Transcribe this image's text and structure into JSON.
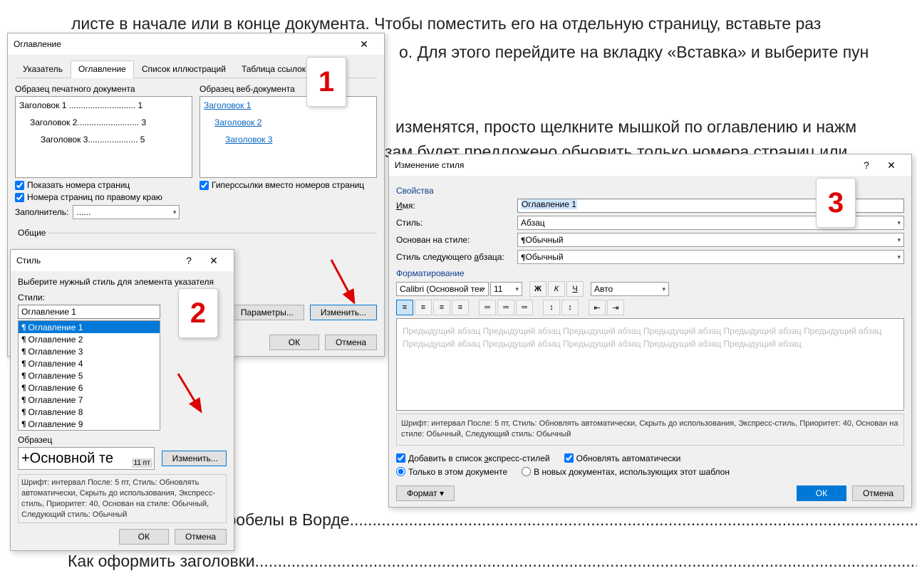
{
  "bg": {
    "line1": "листе в начале или в конце документа. Чтобы поместить его на отдельную страницу, вставьте раз",
    "line2": "о. Для этого перейдите на вкладку «Вставка» и выберите пун",
    "line3": "изменятся, просто щелкните мышкой по оглавлению и нажм",
    "line4": "зам будет предложено обновить только номера страниц или",
    "line5": "Как убрать лишние пробелы в Ворде",
    "line6": "Как оформить заголовки"
  },
  "dlg1": {
    "title": "Оглавление",
    "tabs": [
      "Указатель",
      "Оглавление",
      "Список иллюстраций",
      "Таблица ссылок"
    ],
    "preview_print_label": "Образец печатного документа",
    "preview_web_label": "Образец веб-документа",
    "print_lines": [
      "Заголовок 1 ............................ 1",
      "Заголовок 2.......................... 3",
      "Заголовок 3..................... 5"
    ],
    "web_lines": [
      "Заголовок 1",
      "Заголовок 2",
      "Заголовок 3"
    ],
    "chk_show_pages": "Показать номера страниц",
    "chk_right_align": "Номера страниц по правому краю",
    "chk_hyperlinks": "Гиперссылки вместо номеров страниц",
    "filler_label": "Заполнитель:",
    "filler_value": "......",
    "general_label": "Общие",
    "btn_params": "Параметры...",
    "btn_modify": "Изменить...",
    "btn_ok": "ОК",
    "btn_cancel": "Отмена"
  },
  "dlg2": {
    "title": "Стиль",
    "help": "?",
    "instruction": "Выберите нужный стиль для элемента указателя",
    "styles_label": "Стили:",
    "style_value": "Оглавление 1",
    "style_items": [
      "Оглавление 1",
      "Оглавление 2",
      "Оглавление 3",
      "Оглавление 4",
      "Оглавление 5",
      "Оглавление 6",
      "Оглавление 7",
      "Оглавление 8",
      "Оглавление 9"
    ],
    "preview_label": "Образец",
    "preview_text": "+Основной те",
    "preview_size": "11 пт",
    "btn_modify": "Изменить...",
    "desc": "Шрифт: интервал После:  5 пт, Стиль: Обновлять автоматически, Скрыть до использования, Экспресс-стиль, Приоритет: 40, Основан на стиле: Обычный, Следующий стиль: Обычный",
    "btn_ok": "ОК",
    "btn_cancel": "Отмена"
  },
  "dlg3": {
    "title": "Изменение стиля",
    "section_props": "Свойства",
    "lbl_name": "Имя:",
    "val_name": "Оглавление 1",
    "lbl_style": "Стиль:",
    "val_style": "Абзац",
    "lbl_based": "Основан на стиле:",
    "val_based": "Обычный",
    "lbl_next": "Стиль следующего абзаца:",
    "val_next": "Обычный",
    "section_fmt": "Форматирование",
    "font_name": "Calibri (Основной тек",
    "font_size": "11",
    "bold": "Ж",
    "italic": "К",
    "underline": "Ч",
    "color": "Авто",
    "preview_text": "Предыдущий абзац Предыдущий абзац Предыдущий абзац Предыдущий абзац Предыдущий абзац Предыдущий абзац Предыдущий абзац Предыдущий абзац Предыдущий абзац Предыдущий абзац Предыдущий абзац",
    "desc": "Шрифт: интервал После:  5 пт, Стиль: Обновлять автоматически, Скрыть до использования, Экспресс-стиль, Приоритет: 40, Основан на стиле: Обычный, Следующий стиль: Обычный",
    "chk_express": "Добавить в список экспресс-стилей",
    "chk_auto": "Обновлять автоматически",
    "radio_thisdoc": "Только в этом документе",
    "radio_template": "В новых документах, использующих этот шаблон",
    "btn_format": "Формат",
    "btn_ok": "ОК",
    "btn_cancel": "Отмена"
  },
  "callouts": {
    "c1": "1",
    "c2": "2",
    "c3": "3"
  }
}
